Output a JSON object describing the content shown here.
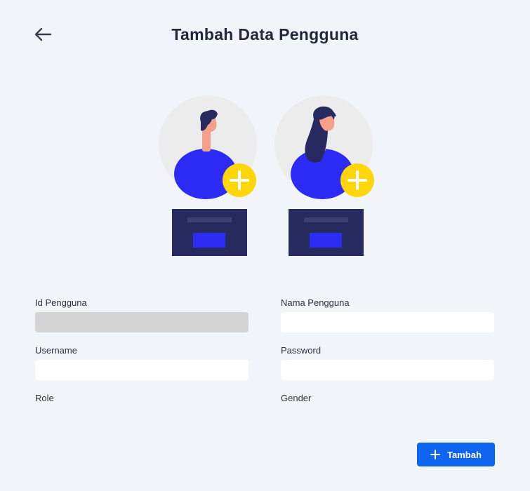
{
  "header": {
    "title": "Tambah Data Pengguna",
    "back_icon": "arrow-left-icon"
  },
  "illustrations": {
    "male": {
      "icon": "add-male-user-icon"
    },
    "female": {
      "icon": "add-female-user-icon"
    }
  },
  "form": {
    "id_pengguna": {
      "label": "Id Pengguna",
      "value": "",
      "placeholder": ""
    },
    "nama_pengguna": {
      "label": "Nama Pengguna",
      "value": "",
      "placeholder": ""
    },
    "username": {
      "label": "Username",
      "value": "",
      "placeholder": ""
    },
    "password": {
      "label": "Password",
      "value": "",
      "placeholder": ""
    },
    "role": {
      "label": "Role"
    },
    "gender": {
      "label": "Gender"
    }
  },
  "actions": {
    "add_label": "Tambah",
    "add_icon": "plus-icon"
  },
  "colors": {
    "background": "#f1f4f9",
    "primary": "#0f64f0",
    "illustration_blue": "#2b2bf5",
    "accent_yellow": "#ffd60a",
    "navy": "#262a5e"
  }
}
